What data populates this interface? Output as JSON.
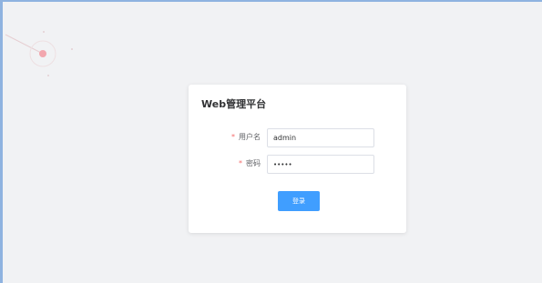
{
  "app": {
    "title": "Web管理平台"
  },
  "form": {
    "username": {
      "label": "用户名",
      "value": "admin",
      "required_mark": "*"
    },
    "password": {
      "label": "密码",
      "value": "•••••",
      "required_mark": "*"
    },
    "submit_label": "登录"
  },
  "colors": {
    "background": "#f1f2f4",
    "frame_border": "#8fb3e0",
    "primary": "#409eff",
    "required": "#f56c6c",
    "decor": "#f2a6ae"
  },
  "icons": [
    "decorative-circle-icon"
  ]
}
